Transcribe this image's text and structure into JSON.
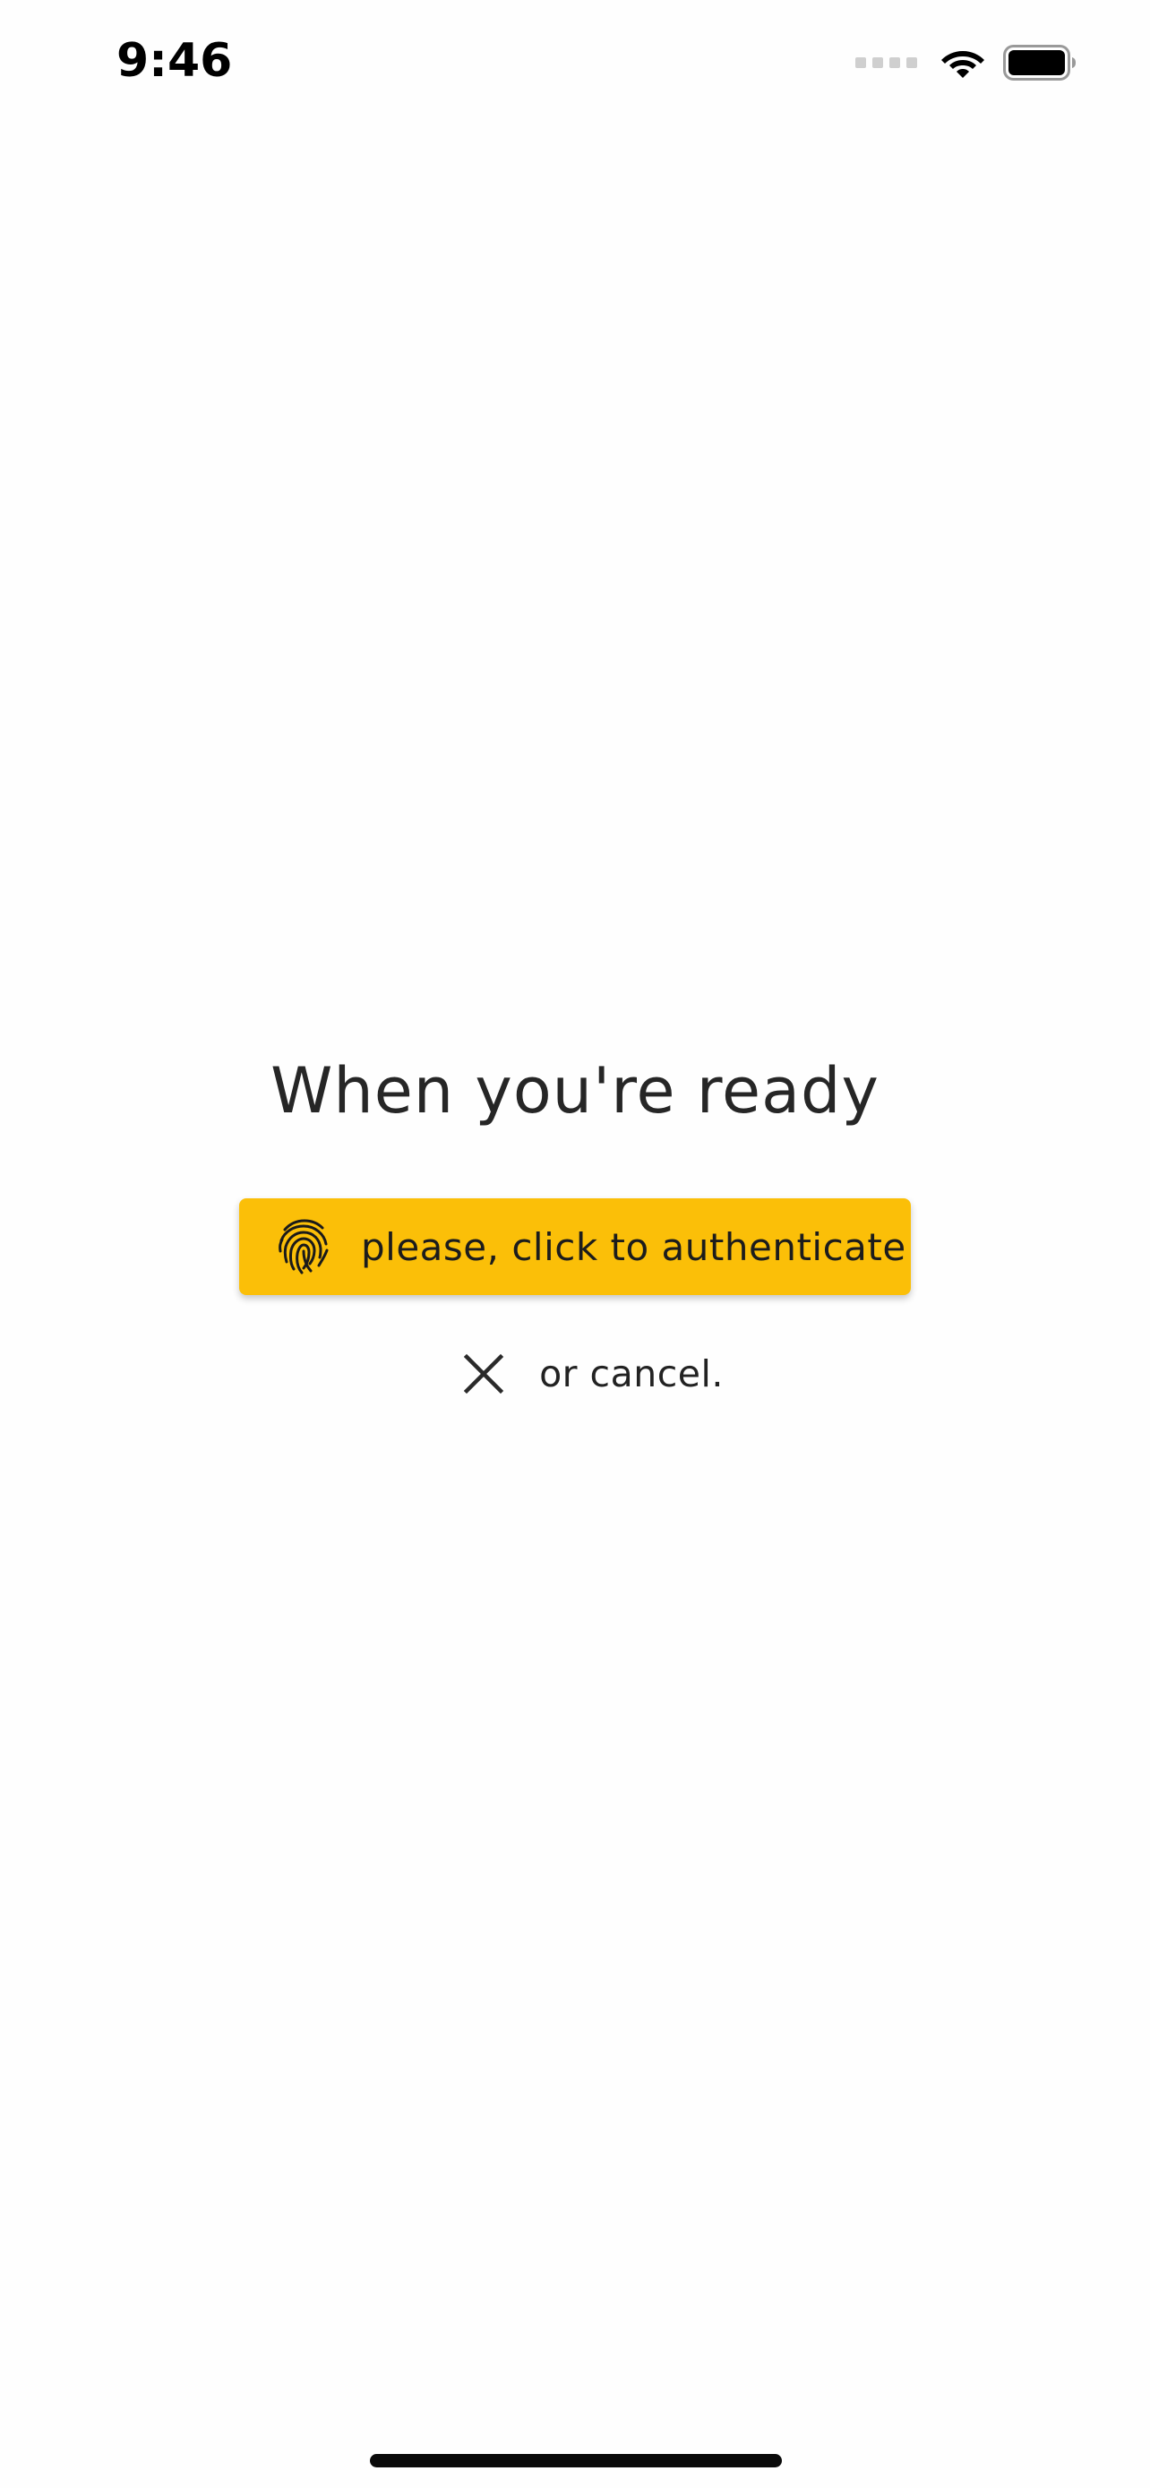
{
  "status_bar": {
    "time": "9:46"
  },
  "main": {
    "title": "When you're ready",
    "auth_button_label": "please, click to authenticate",
    "auth_button_icon": "fingerprint-icon",
    "cancel_label": "or cancel.",
    "cancel_icon": "close-icon"
  },
  "colors": {
    "accent": "#fbbf08",
    "background": "#fefefe",
    "text": "#222222"
  }
}
